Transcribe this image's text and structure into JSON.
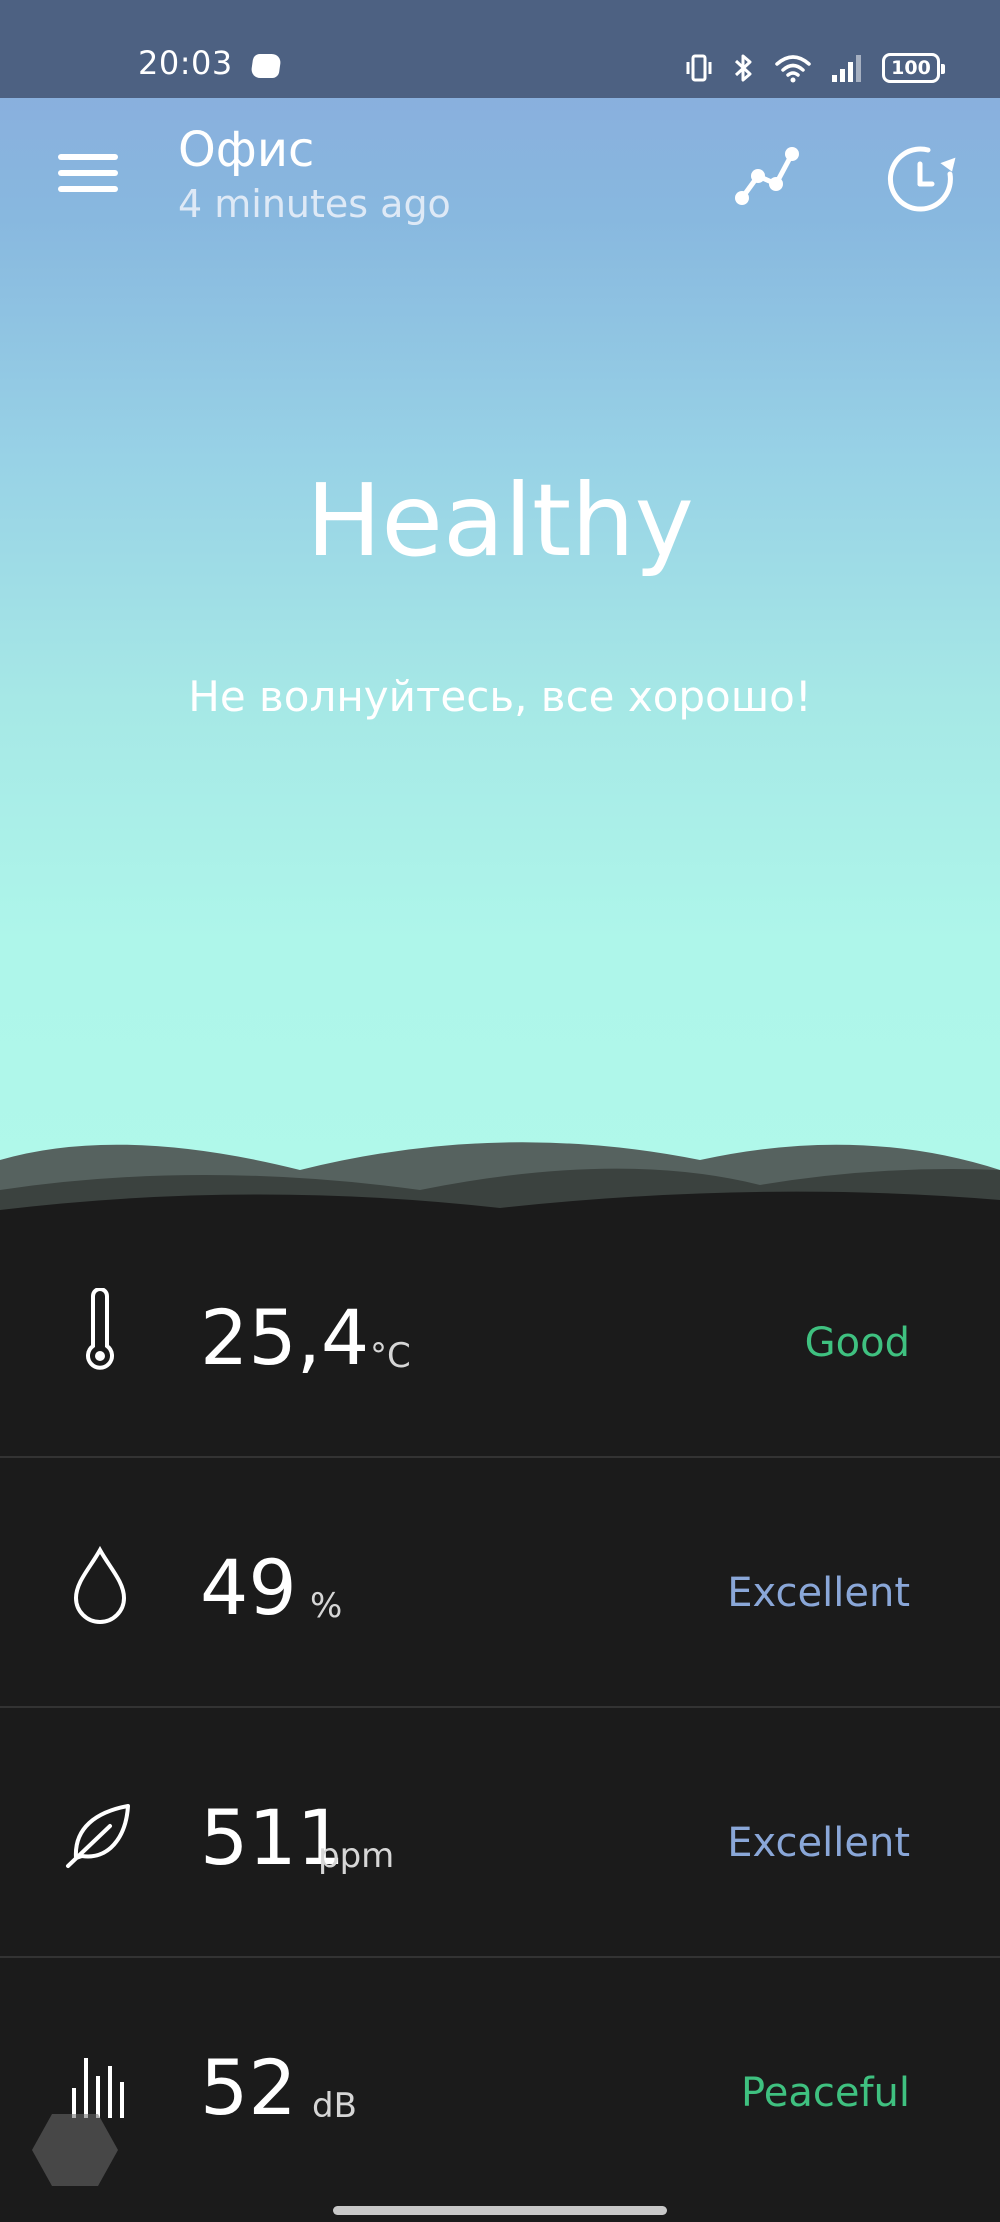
{
  "status_bar": {
    "time": "20:03",
    "battery": "100"
  },
  "header": {
    "title": "Офис",
    "subtitle": "4 minutes ago",
    "icons": [
      "menu-icon",
      "graph-icon",
      "history-icon"
    ]
  },
  "hero": {
    "status": "Healthy",
    "message": "Не волнуйтесь, все хорошо!"
  },
  "metrics": [
    {
      "icon": "thermometer-icon",
      "value": "25,4",
      "unit": "°C",
      "rating": "Good",
      "rating_color": "#3fc180"
    },
    {
      "icon": "droplet-icon",
      "value": "49",
      "unit": "%",
      "rating": "Excellent",
      "rating_color": "#8aa7d8"
    },
    {
      "icon": "leaf-icon",
      "value": "511",
      "unit": "ppm",
      "rating": "Excellent",
      "rating_color": "#8aa7d8"
    },
    {
      "icon": "sound-bars-icon",
      "value": "52",
      "unit": "dB",
      "rating": "Peaceful",
      "rating_color": "#3fc180"
    }
  ],
  "colors": {
    "sky_top": "#8aa9dc",
    "sky_bottom": "#b0f8ea",
    "panel_bg": "#1b1b1b",
    "good": "#3fc180",
    "excellent": "#8aa7d8"
  }
}
